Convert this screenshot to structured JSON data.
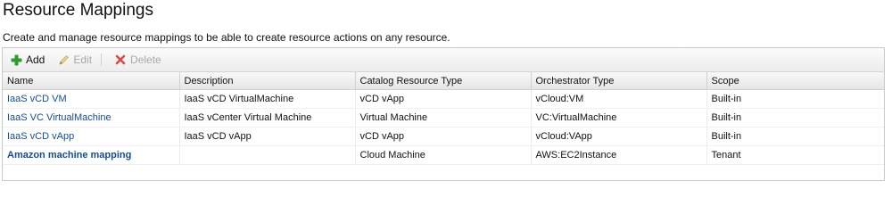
{
  "header": {
    "title": "Resource Mappings",
    "description": "Create and manage resource mappings to be able to create resource actions on any resource."
  },
  "toolbar": {
    "add_label": "Add",
    "edit_label": "Edit",
    "delete_label": "Delete"
  },
  "table": {
    "columns": [
      "Name",
      "Description",
      "Catalog Resource Type",
      "Orchestrator Type",
      "Scope"
    ],
    "rows": [
      {
        "name": "IaaS vCD VM",
        "description": "IaaS vCD VirtualMachine",
        "catalog_type": "vCD vApp",
        "orchestrator_type": "vCloud:VM",
        "scope": "Built-in"
      },
      {
        "name": "IaaS VC VirtualMachine",
        "description": "IaaS vCenter Virtual Machine",
        "catalog_type": "Virtual Machine",
        "orchestrator_type": "VC:VirtualMachine",
        "scope": "Built-in"
      },
      {
        "name": "IaaS vCD vApp",
        "description": "IaaS vCD vApp",
        "catalog_type": "vCD vApp",
        "orchestrator_type": "vCloud:VApp",
        "scope": "Built-in"
      },
      {
        "name": "Amazon machine mapping",
        "description": "",
        "catalog_type": "Cloud Machine",
        "orchestrator_type": "AWS:EC2Instance",
        "scope": "Tenant"
      }
    ]
  },
  "colors": {
    "link": "#1a4c86",
    "add_icon": "#2e9a2e",
    "delete_icon": "#d94a4a"
  },
  "icons": {
    "add": "plus-icon",
    "edit": "pencil-icon",
    "delete": "x-icon"
  }
}
